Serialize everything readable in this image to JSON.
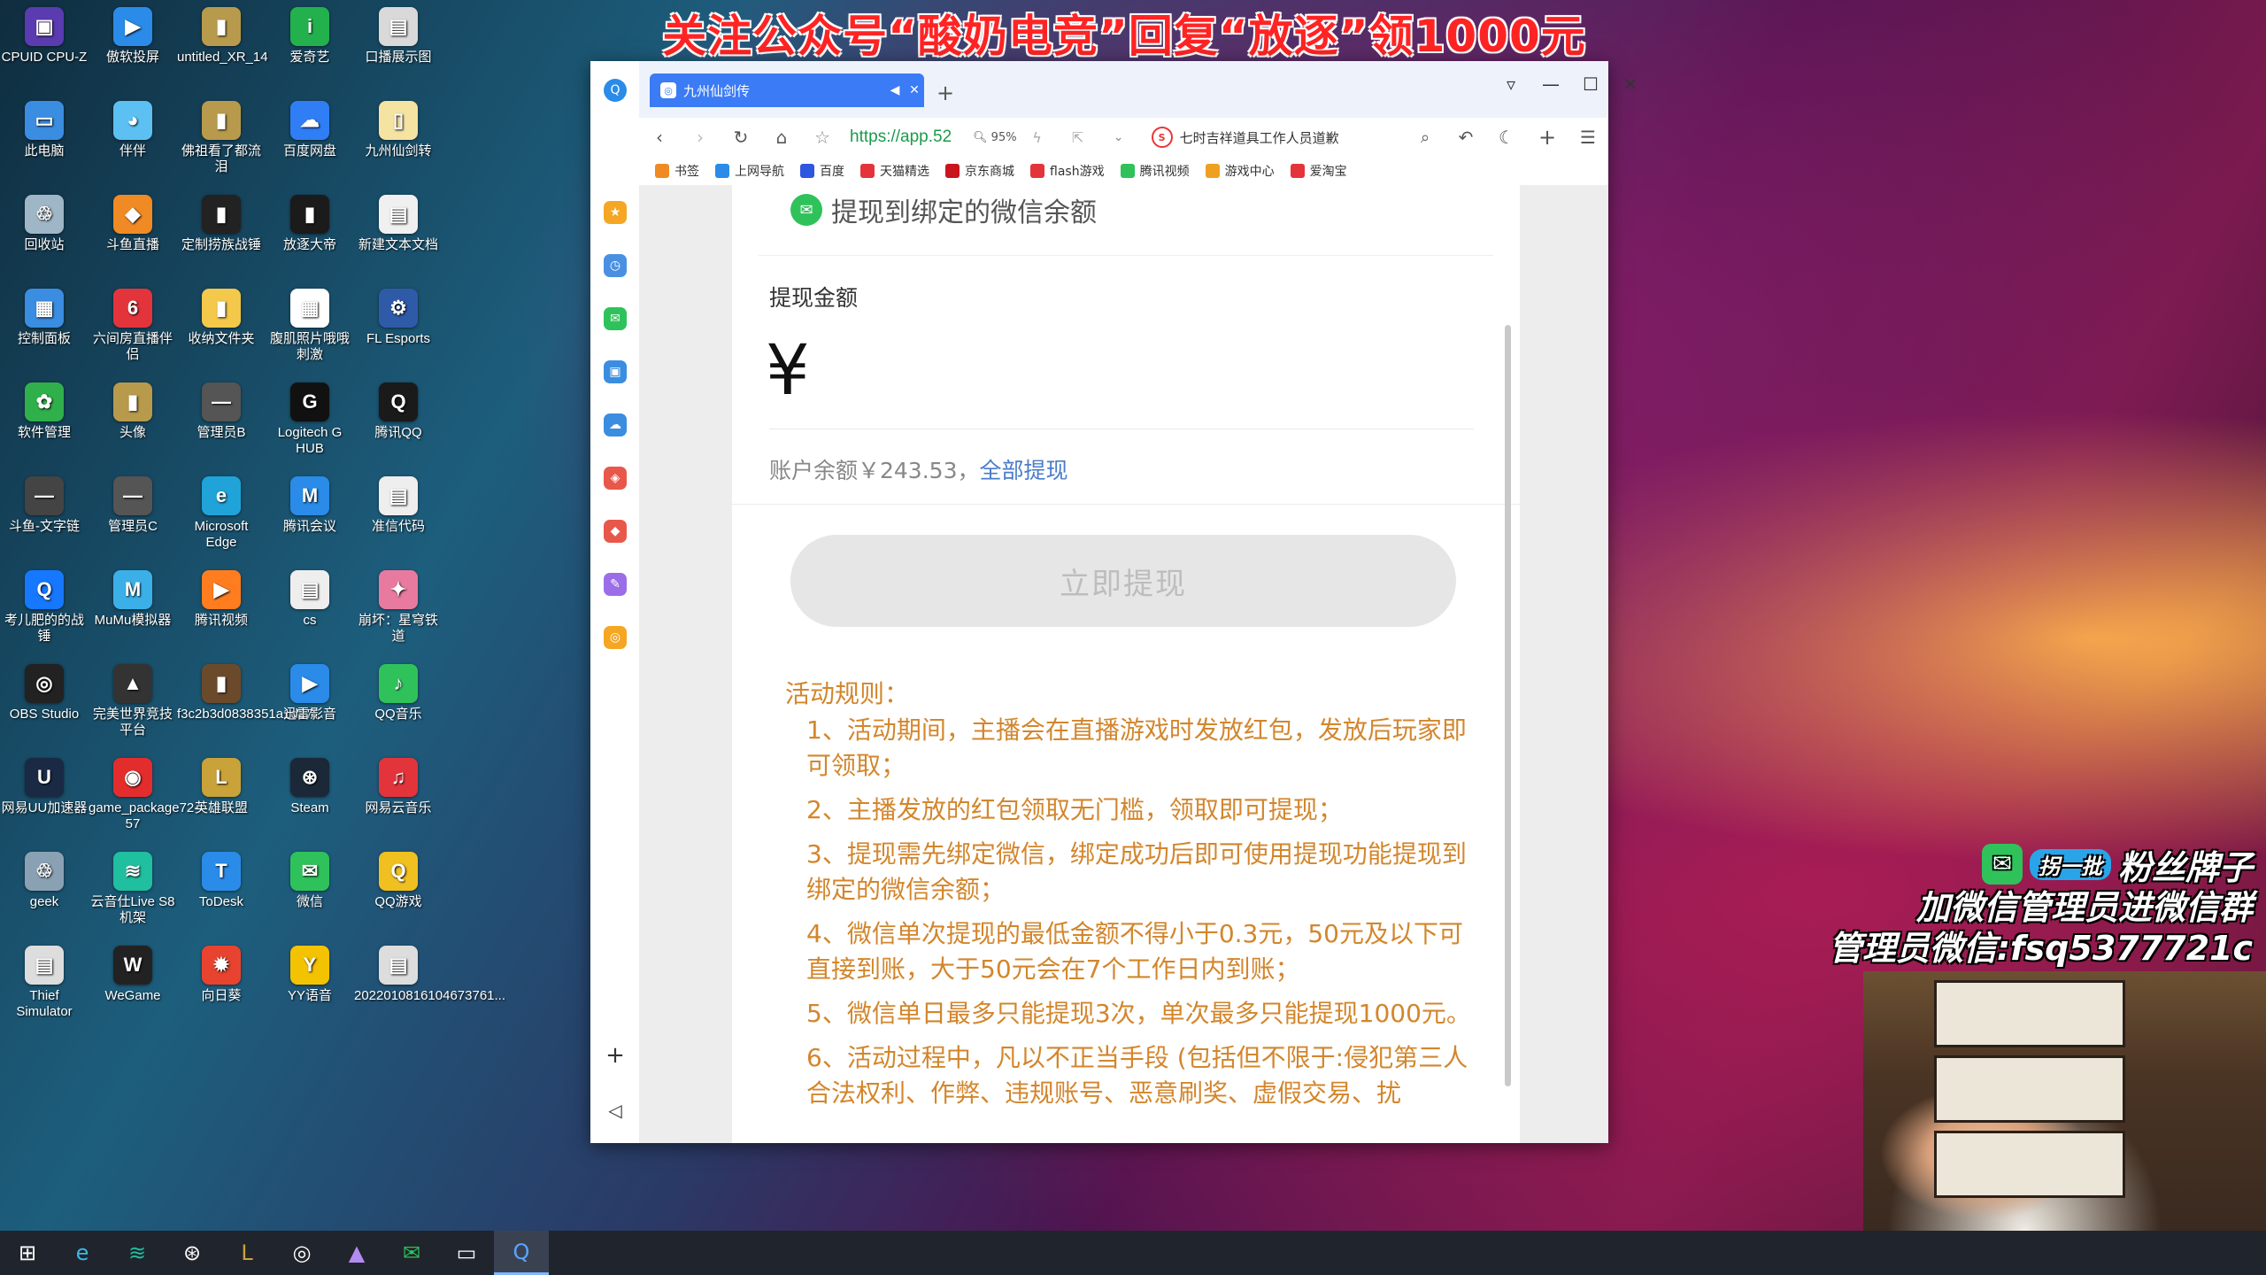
{
  "banner": "关注公众号“酸奶电竞”回复“放逐”领1000元",
  "desktop_icons": [
    {
      "label": "CPUID CPU-Z",
      "color": "#5a3bb0",
      "glyph": "▣"
    },
    {
      "label": "傲软投屏",
      "color": "#2a8be8",
      "glyph": "▶"
    },
    {
      "label": "untitled_XR_14",
      "color": "#b89a4c",
      "glyph": "▮"
    },
    {
      "label": "爱奇艺",
      "color": "#22b14c",
      "glyph": "i"
    },
    {
      "label": "口播展示图",
      "color": "#d9d9d9",
      "glyph": "▤"
    },
    {
      "label": "此电脑",
      "color": "#3a8de0",
      "glyph": "▭"
    },
    {
      "label": "伴伴",
      "color": "#5cc0f2",
      "glyph": "◕"
    },
    {
      "label": "佛祖看了都流泪",
      "color": "#b89a4c",
      "glyph": "▮"
    },
    {
      "label": "百度网盘",
      "color": "#2f7ef5",
      "glyph": "☁"
    },
    {
      "label": "九州仙剑转",
      "color": "#f4e3a1",
      "glyph": "▯"
    },
    {
      "label": "回收站",
      "color": "#9fb6c7",
      "glyph": "♲"
    },
    {
      "label": "斗鱼直播",
      "color": "#f08a24",
      "glyph": "◆"
    },
    {
      "label": "定制捞族战锤",
      "color": "#222222",
      "glyph": "▮"
    },
    {
      "label": "放逐大帝",
      "color": "#1b1b1b",
      "glyph": "▮"
    },
    {
      "label": "新建文本文档",
      "color": "#f0f0f0",
      "glyph": "▤"
    },
    {
      "label": "控制面板",
      "color": "#3a8de0",
      "glyph": "▦"
    },
    {
      "label": "六间房直播伴侣",
      "color": "#e3343c",
      "glyph": "6"
    },
    {
      "label": "收纳文件夹",
      "color": "#f3c84b",
      "glyph": "▮"
    },
    {
      "label": "腹肌照片哦哦刺激",
      "color": "#ffffff",
      "glyph": "▦"
    },
    {
      "label": "FL Esports",
      "color": "#2e5aa8",
      "glyph": "⚙"
    },
    {
      "label": "软件管理",
      "color": "#2fb04b",
      "glyph": "✿"
    },
    {
      "label": "头像",
      "color": "#b89a4c",
      "glyph": "▮"
    },
    {
      "label": "管理员B",
      "color": "#555555",
      "glyph": "—"
    },
    {
      "label": "Logitech G HUB",
      "color": "#111111",
      "glyph": "G"
    },
    {
      "label": "腾讯QQ",
      "color": "#1a1a1a",
      "glyph": "Q"
    },
    {
      "label": "斗鱼-文字链",
      "color": "#444444",
      "glyph": "—"
    },
    {
      "label": "管理员C",
      "color": "#555555",
      "glyph": "—"
    },
    {
      "label": "Microsoft Edge",
      "color": "#1fa3d9",
      "glyph": "e"
    },
    {
      "label": "腾讯会议",
      "color": "#2a8be8",
      "glyph": "M"
    },
    {
      "label": "准信代码",
      "color": "#eeeeee",
      "glyph": "▤"
    },
    {
      "label": "考儿肥的的战锤",
      "color": "#1677ff",
      "glyph": "Q"
    },
    {
      "label": "MuMu模拟器",
      "color": "#3bb0e8",
      "glyph": "M"
    },
    {
      "label": "腾讯视频",
      "color": "#ff7d1f",
      "glyph": "▶"
    },
    {
      "label": "cs",
      "color": "#eeeeee",
      "glyph": "▤"
    },
    {
      "label": "崩坏：星穹铁道",
      "color": "#e87aa0",
      "glyph": "✦"
    },
    {
      "label": "OBS Studio",
      "color": "#222222",
      "glyph": "◎"
    },
    {
      "label": "完美世界竞技平台",
      "color": "#333333",
      "glyph": "▲"
    },
    {
      "label": "f3c2b3d0838351a1d27...",
      "color": "#6b4a2c",
      "glyph": "▮"
    },
    {
      "label": "迅雷影音",
      "color": "#2a8be8",
      "glyph": "▶"
    },
    {
      "label": "QQ音乐",
      "color": "#2fc25b",
      "glyph": "♪"
    },
    {
      "label": "网易UU加速器",
      "color": "#1a2a44",
      "glyph": "U"
    },
    {
      "label": "game_package72-57",
      "color": "#e32d2d",
      "glyph": "◉"
    },
    {
      "label": "英雄联盟",
      "color": "#c9a23a",
      "glyph": "L"
    },
    {
      "label": "Steam",
      "color": "#1b2838",
      "glyph": "⊛"
    },
    {
      "label": "网易云音乐",
      "color": "#e3343c",
      "glyph": "♫"
    },
    {
      "label": "geek",
      "color": "#8aa1b4",
      "glyph": "♲"
    },
    {
      "label": "云音仕Live S8机架",
      "color": "#1fbfa0",
      "glyph": "≋"
    },
    {
      "label": "ToDesk",
      "color": "#2a8be8",
      "glyph": "T"
    },
    {
      "label": "微信",
      "color": "#2fc25b",
      "glyph": "✉"
    },
    {
      "label": "QQ游戏",
      "color": "#f0c020",
      "glyph": "Q"
    },
    {
      "label": "Thief Simulator",
      "color": "#dddddd",
      "glyph": "▤"
    },
    {
      "label": "WeGame",
      "color": "#222222",
      "glyph": "W"
    },
    {
      "label": "向日葵",
      "color": "#e8432f",
      "glyph": "✹"
    },
    {
      "label": "YY语音",
      "color": "#f3c200",
      "glyph": "Y"
    },
    {
      "label": "2022010816104673761...",
      "color": "#dddddd",
      "glyph": "▤"
    }
  ],
  "browser": {
    "tab_title": "九州仙剑传",
    "url": "https://app.52",
    "zoom": "95%",
    "search_hint": "七时吉祥道具工作人员道歉",
    "bookmarks": [
      {
        "label": "书签",
        "color": "#f08a24"
      },
      {
        "label": "上网导航",
        "color": "#2a8be8"
      },
      {
        "label": "百度",
        "color": "#2f56e0"
      },
      {
        "label": "天猫精选",
        "color": "#e3343c"
      },
      {
        "label": "京东商城",
        "color": "#c9151e"
      },
      {
        "label": "flash游戏",
        "color": "#e3343c"
      },
      {
        "label": "腾讯视频",
        "color": "#2fc25b"
      },
      {
        "label": "游戏中心",
        "color": "#f0a020"
      },
      {
        "label": "爱淘宝",
        "color": "#e3343c"
      }
    ],
    "left_rail": [
      {
        "color": "#f5a623",
        "glyph": "★"
      },
      {
        "color": "#4a90e2",
        "glyph": "◷"
      },
      {
        "color": "#2fc25b",
        "glyph": "✉"
      },
      {
        "color": "#3a8de0",
        "glyph": "▣"
      },
      {
        "color": "#3a8de0",
        "glyph": "☁"
      },
      {
        "color": "#e8584a",
        "glyph": "◈"
      },
      {
        "color": "#e8584a",
        "glyph": "◆"
      },
      {
        "color": "#9b6ee8",
        "glyph": "✎"
      },
      {
        "color": "#f5a623",
        "glyph": "◎"
      }
    ]
  },
  "page": {
    "wechat_header": "提现到绑定的微信余额",
    "amount_label": "提现金额",
    "currency": "¥",
    "balance_text": "账户余额￥243.53，",
    "withdraw_all": "全部提现",
    "withdraw_button": "立即提现",
    "rules_title": "活动规则：",
    "rules": [
      "1、活动期间，主播会在直播游戏时发放红包，发放后玩家即可领取；",
      "2、主播发放的红包领取无门槛，领取即可提现；",
      "3、提现需先绑定微信，绑定成功后即可使用提现功能提现到绑定的微信余额；",
      "4、微信单次提现的最低金额不得小于0.3元，50元及以下可直接到账，大于50元会在7个工作日内到账；",
      "5、微信单日最多只能提现3次，单次最多只能提现1000元。",
      "6、活动过程中，凡以不正当手段 (包括但不限于:侵犯第三人合法权利、作弊、违规账号、恶意刷奖、虚假交易、扰"
    ]
  },
  "overlay": {
    "badge": "拐一批",
    "line1": "粉丝牌子",
    "line2": "加微信管理员进微信群",
    "line3": "管理员微信:fsq5377721c"
  }
}
